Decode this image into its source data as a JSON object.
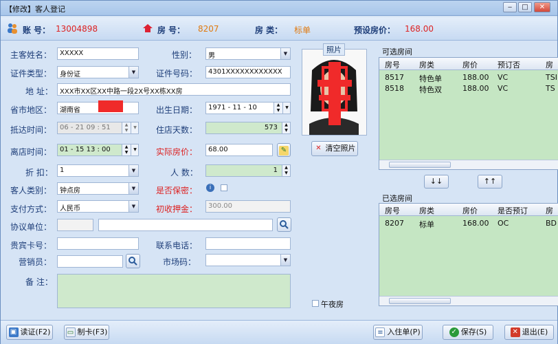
{
  "window": {
    "title": "【修改】客人登记",
    "min": "‒",
    "max": "□",
    "close": "✕"
  },
  "info": {
    "account_label": "账 号：",
    "account_value": "13004898",
    "room_label": "房 号：",
    "room_value": "8207",
    "roomtype_label": "房 类：",
    "roomtype_value": "标单",
    "price_label": "预设房价：",
    "price_value": "168.00"
  },
  "form": {
    "guest_name_label": "主客姓名：",
    "guest_name": "XXXXX",
    "gender_label": "性别：",
    "gender": "男",
    "id_type_label": "证件类型：",
    "id_type": "身份证",
    "id_no_label": "证件号码：",
    "id_no": "4301XXXXXXXXXXXX",
    "address_label": "地 址：",
    "address": "XXX市XX区XX中路一段2X号XX栋XX房",
    "region_label": "省市地区：",
    "region": "湖南省",
    "birth_label": "出生日期：",
    "birth": "1971 - 11 - 10",
    "arrive_label": "抵达时间：",
    "arrive": "06 - 21   09 : 51",
    "days_label": "住店天数：",
    "days": "573",
    "leave_label": "离店时间：",
    "leave": "01 - 15   13 : 00",
    "actual_price_label": "实际房价：",
    "actual_price": "68.00",
    "discount_label": "折 扣：",
    "discount": "1",
    "persons_label": "人 数：",
    "persons": "1",
    "guest_type_label": "客人类别：",
    "guest_type": "钟点房",
    "secret_label": "是否保密：",
    "pay_label": "支付方式：",
    "pay": "人民币",
    "deposit_label": "初收押金：",
    "deposit": "300.00",
    "agreement_label": "协议单位：",
    "vip_label": "贵宾卡号：",
    "phone_label": "联系电话：",
    "sales_label": "营销员：",
    "market_label": "市场码：",
    "remark_label": "备 注："
  },
  "photo": {
    "title": "照片",
    "clear_button": "清空照片"
  },
  "available": {
    "title": "可选房间",
    "headers": [
      "房号",
      "房类",
      "房价",
      "预订否",
      "房"
    ],
    "rows": [
      [
        "8517",
        "特色单",
        "188.00",
        "VC",
        "TSI"
      ],
      [
        "8518",
        "特色双",
        "188.00",
        "VC",
        "TS"
      ]
    ]
  },
  "move": {
    "down": "↓↓",
    "up": "↑↑"
  },
  "selected": {
    "title": "已选房间",
    "headers": [
      "房号",
      "房类",
      "房价",
      "是否预订",
      "房"
    ],
    "rows": [
      [
        "8207",
        "标单",
        "168.00",
        "OC",
        "BD"
      ]
    ]
  },
  "midnight_label": "午夜房",
  "buttons": {
    "read_id": "读证(F2)",
    "make_card": "制卡(F3)",
    "checkin_form": "入住单(P)",
    "save": "保存(S)",
    "exit": "退出(E)"
  },
  "colors": {
    "accent": "#1f3f7a",
    "red": "#dd2222",
    "green_field": "#cfe9cc"
  }
}
